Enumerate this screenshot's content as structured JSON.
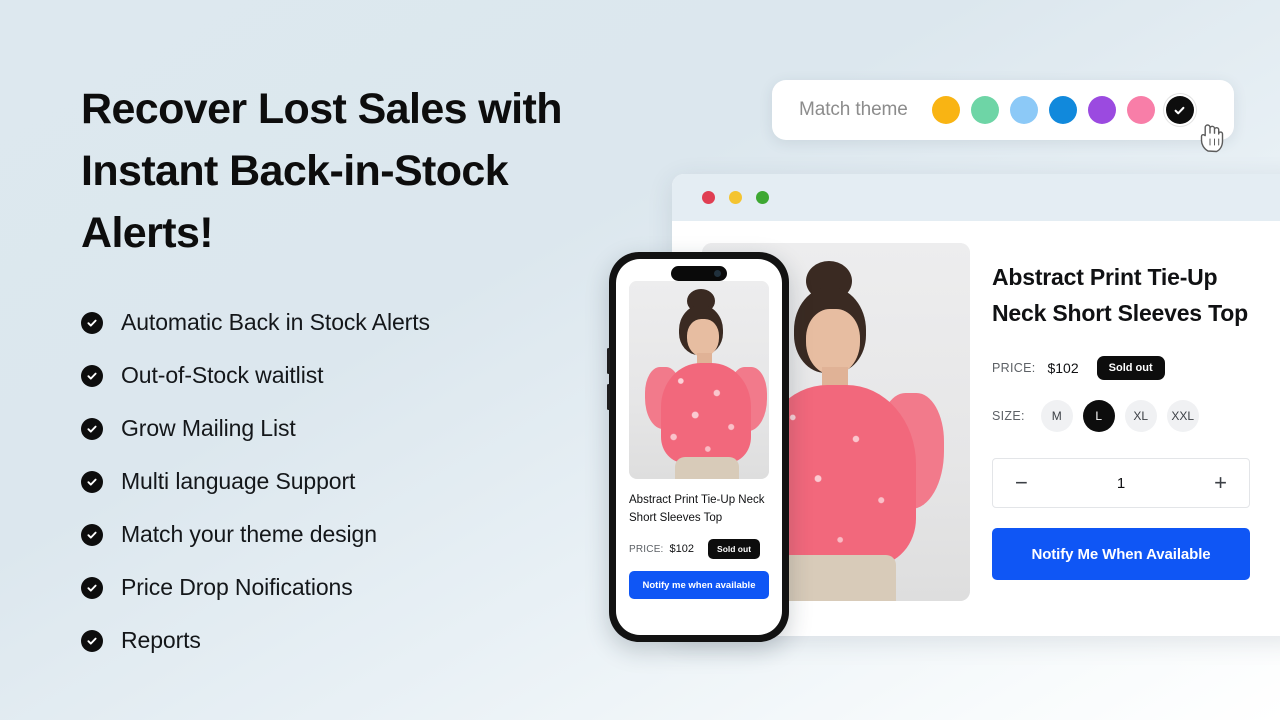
{
  "hero": {
    "headline": "Recover Lost Sales with Instant Back-in-Stock Alerts!",
    "features": [
      {
        "label": "Automatic Back in Stock Alerts",
        "icon": "check-circle-icon"
      },
      {
        "label": "Out-of-Stock waitlist",
        "icon": "check-circle-icon"
      },
      {
        "label": "Grow Mailing List",
        "icon": "check-circle-icon"
      },
      {
        "label": "Multi language Support",
        "icon": "check-circle-icon"
      },
      {
        "label": "Match your theme design",
        "icon": "check-circle-icon"
      },
      {
        "label": "Price Drop Noifications",
        "icon": "check-circle-icon"
      },
      {
        "label": "Reports",
        "icon": "check-circle-icon"
      }
    ]
  },
  "theme_picker": {
    "label": "Match theme",
    "cursor_icon": "pointing-hand-cursor-icon",
    "swatches": [
      {
        "name": "amber",
        "color": "#f9b413",
        "selected": false
      },
      {
        "name": "mint",
        "color": "#6ed5a6",
        "selected": false
      },
      {
        "name": "light-blue",
        "color": "#8cc9f7",
        "selected": false
      },
      {
        "name": "blue",
        "color": "#1189dc",
        "selected": false
      },
      {
        "name": "purple",
        "color": "#9b4ae0",
        "selected": false
      },
      {
        "name": "pink",
        "color": "#f87ea8",
        "selected": false
      },
      {
        "name": "black",
        "color": "#0d0d0d",
        "selected": true
      }
    ]
  },
  "browser": {
    "traffic_lights": [
      {
        "name": "close",
        "color": "#e03e52"
      },
      {
        "name": "minimize",
        "color": "#f4c430"
      },
      {
        "name": "maximize",
        "color": "#3ea832"
      }
    ],
    "product": {
      "title": "Abstract Print Tie-Up Neck Short Sleeves Top",
      "price_label": "PRICE:",
      "price_value": "$102",
      "stock_badge": "Sold out",
      "size_label": "SIZE:",
      "sizes": [
        {
          "label": "M",
          "selected": false
        },
        {
          "label": "L",
          "selected": true
        },
        {
          "label": "XL",
          "selected": false
        },
        {
          "label": "XXL",
          "selected": false
        }
      ],
      "quantity": {
        "decrement": "−",
        "value": "1",
        "increment": "+"
      },
      "cta_label": "Notify Me When Available",
      "cta_color": "#0f56f5"
    }
  },
  "phone": {
    "product": {
      "title": "Abstract Print Tie-Up Neck Short Sleeves Top",
      "price_label": "PRICE:",
      "price_value": "$102",
      "stock_badge": "Sold out",
      "cta_label": "Notify me when available"
    }
  }
}
